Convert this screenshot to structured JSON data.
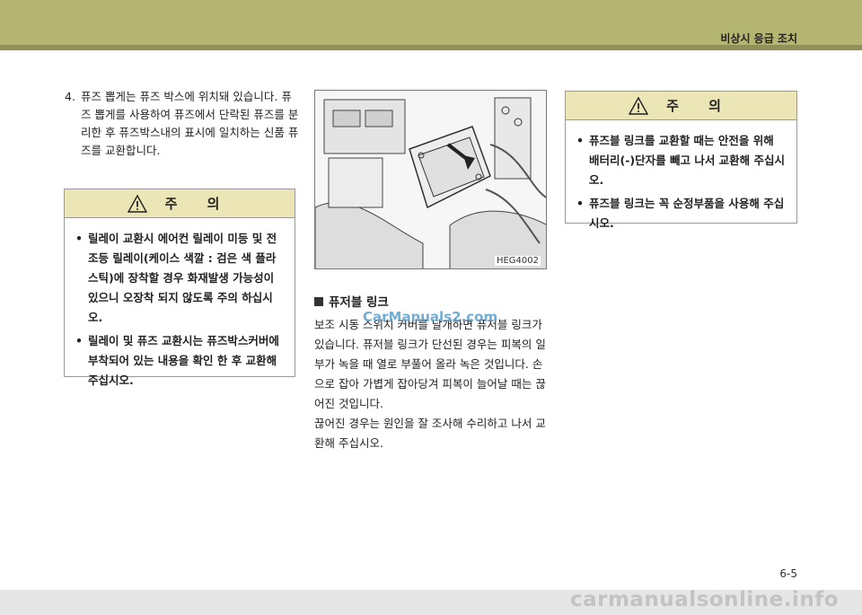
{
  "header": {
    "section_title": "비상시 응급 조치"
  },
  "step": {
    "number": "4.",
    "text": "퓨즈 뽑게는 퓨즈 박스에 위치돼 있습니다. 퓨즈 뽑게를 사용하여 퓨즈에서 단락된 퓨즈를 분리한 후 퓨즈박스내의 표시에 일치하는 신품 퓨즈를 교환합니다."
  },
  "caution_left": {
    "title": "주 의",
    "items": [
      "릴레이 교환시 에어컨 릴레이 미등 및 전조등 릴레이(케이스 색깔 : 검은 색 플라스틱)에 장착할 경우 화재발생 가능성이 있으니 오장착 되지 않도록 주의 하십시오.",
      "릴레이 및 퓨즈 교환시는 퓨즈박스커버에 부착되어 있는 내용을 확인 한 후 교환해 주십시오."
    ]
  },
  "figure": {
    "code": "HEG4002"
  },
  "fuse_link": {
    "title": "퓨저블 링크",
    "paragraphs": [
      "보조 시동 스위치 커버를 날개하면 퓨저블 링크가 있습니다. 퓨저블 링크가 단선된 경우는 피복의 일부가 녹을 때 열로 부풀어 올라 녹은 것입니다. 손으로 잡아 가볍게 잡아당겨 피복이 늘어날 때는 끊어진 것입니다.",
      "끊어진 경우는 원인을 잘 조사해 수리하고 나서 교환해 주십시오."
    ]
  },
  "caution_right": {
    "title": "주 의",
    "items": [
      "퓨즈블 링크를 교환할 때는 안전을 위해 배터리(-)단자를 빼고 나서 교환해 주십시오.",
      "퓨즈블 링크는 꼭 순정부품을 사용해 주십시오."
    ]
  },
  "watermarks": {
    "top": "CarManuals2.com",
    "bottom": "carmanualsonline.info"
  },
  "page_number": "6-5"
}
